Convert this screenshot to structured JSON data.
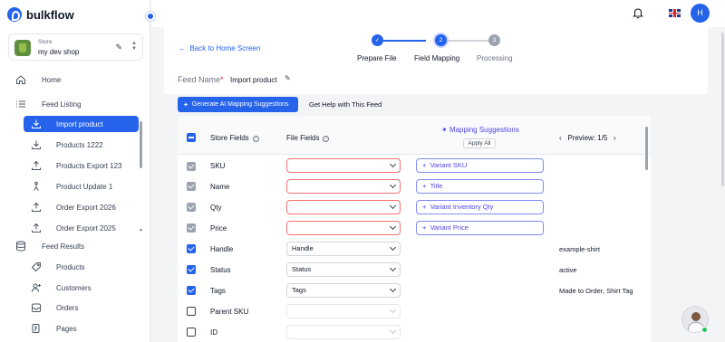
{
  "app": {
    "name": "bulkflow"
  },
  "store": {
    "label": "Store",
    "name": "my dev shop"
  },
  "sidebar": {
    "home": "Home",
    "feed_listing": "Feed Listing",
    "listing_items": [
      {
        "label": "Import product"
      },
      {
        "label": "Products 1222"
      },
      {
        "label": "Products Export 123"
      },
      {
        "label": "Product Update 1"
      },
      {
        "label": "Order Export 2026"
      },
      {
        "label": "Order Export 2025"
      }
    ],
    "feed_results": "Feed Results",
    "result_items": [
      {
        "label": "Products"
      },
      {
        "label": "Customers"
      },
      {
        "label": "Orders"
      },
      {
        "label": "Pages"
      }
    ]
  },
  "user": {
    "initial": "H"
  },
  "page": {
    "back_label": "Back to Home Screen",
    "steps": [
      {
        "num": "✓",
        "label": "Prepare File",
        "state": "done"
      },
      {
        "num": "2",
        "label": "Field Mapping",
        "state": "active"
      },
      {
        "num": "3",
        "label": "Processing",
        "state": "pending"
      }
    ],
    "feed_name_label": "Feed Name",
    "feed_name_required": "*",
    "feed_name_value": "Import product"
  },
  "actions": {
    "ai_button": "Generate AI Mapping Suggestions",
    "help_link": "Get Help with This Feed"
  },
  "table": {
    "headers": {
      "store_fields": "Store Fields",
      "file_fields": "File Fields",
      "mapping_suggestions": "Mapping Suggestions",
      "apply_all": "Apply All",
      "preview": "Preview: 1/5"
    },
    "rows": [
      {
        "field": "SKU",
        "checkbox": "disabled",
        "file_field": "",
        "select_state": "error",
        "suggestion": "Variant SKU",
        "preview": ""
      },
      {
        "field": "Name",
        "checkbox": "disabled",
        "file_field": "",
        "select_state": "error",
        "suggestion": "Title",
        "preview": ""
      },
      {
        "field": "Qty",
        "checkbox": "disabled",
        "file_field": "",
        "select_state": "error",
        "suggestion": "Variant Inventory Qty",
        "preview": ""
      },
      {
        "field": "Price",
        "checkbox": "disabled",
        "file_field": "",
        "select_state": "error",
        "suggestion": "Variant Price",
        "preview": ""
      },
      {
        "field": "Handle",
        "checkbox": "checked",
        "file_field": "Handle",
        "select_state": "normal",
        "suggestion": "",
        "preview": "example-shirt"
      },
      {
        "field": "Status",
        "checkbox": "checked",
        "file_field": "Status",
        "select_state": "normal",
        "suggestion": "",
        "preview": "active"
      },
      {
        "field": "Tags",
        "checkbox": "checked",
        "file_field": "Tags",
        "select_state": "normal",
        "suggestion": "",
        "preview": "Made to Order, Shirt Tag"
      },
      {
        "field": "Parent SKU",
        "checkbox": "empty",
        "file_field": "",
        "select_state": "faded",
        "suggestion": "",
        "preview": ""
      },
      {
        "field": "ID",
        "checkbox": "empty",
        "file_field": "",
        "select_state": "faded",
        "suggestion": "",
        "preview": ""
      }
    ]
  },
  "colors": {
    "accent": "#2563eb",
    "error": "#f87171",
    "suggestion": "#4f46e5"
  }
}
